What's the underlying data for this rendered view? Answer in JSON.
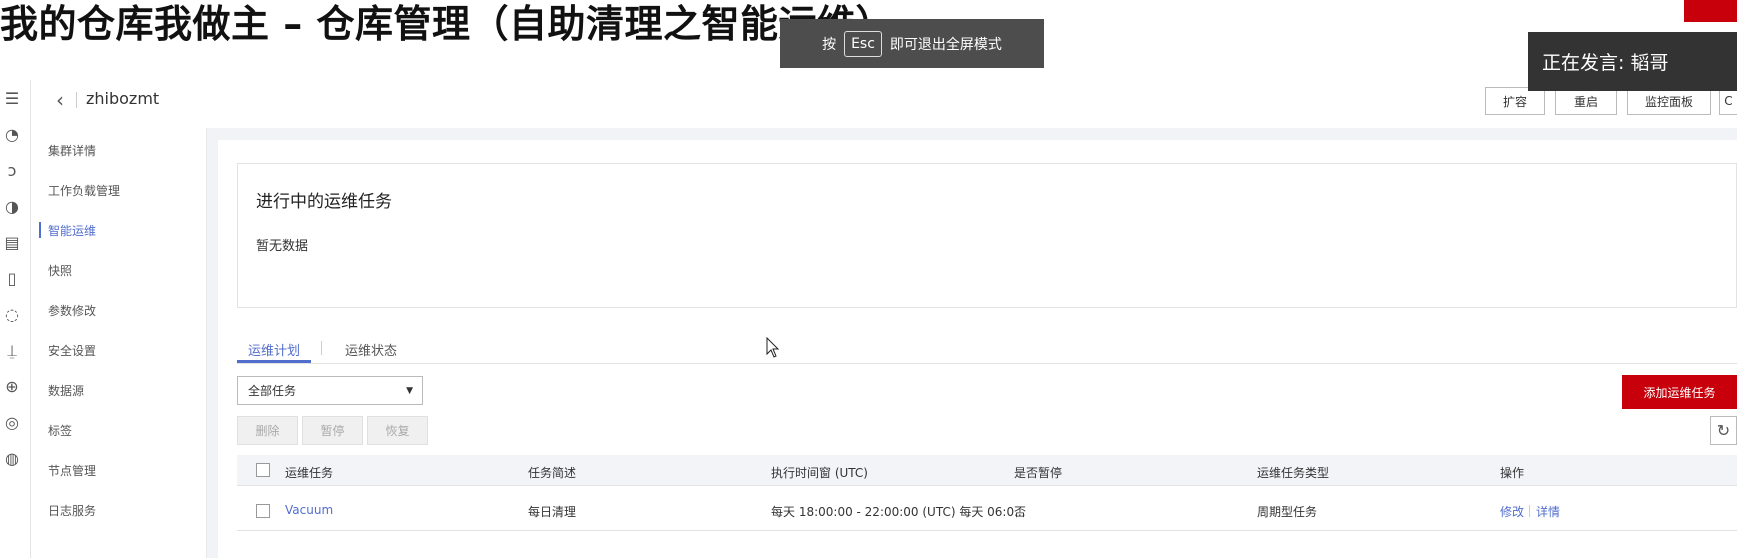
{
  "slide": {
    "title": "我的仓库我做主 – 仓库管理（自助清理之智能运维）"
  },
  "fullscreen_toast": {
    "before": "按",
    "key": "Esc",
    "after": "即可退出全屏模式"
  },
  "speaker": {
    "label": "正在发言: 韬哥"
  },
  "header": {
    "cluster_name": "zhibozmt",
    "buttons": [
      "扩容",
      "重启",
      "监控面板"
    ]
  },
  "nav": {
    "items": [
      "集群详情",
      "工作负载管理",
      "智能运维",
      "快照",
      "参数修改",
      "安全设置",
      "数据源",
      "标签",
      "节点管理",
      "日志服务"
    ],
    "active_index": 2
  },
  "card": {
    "title": "进行中的运维任务",
    "empty_text": "暂无数据"
  },
  "tabs": [
    {
      "label": "运维计划",
      "active": true
    },
    {
      "label": "运维状态",
      "active": false
    }
  ],
  "filter": {
    "value": "全部任务"
  },
  "actions": {
    "delete": "删除",
    "pause": "暂停",
    "resume": "恢复",
    "add": "添加运维任务"
  },
  "table": {
    "headers": [
      "运维任务",
      "任务简述",
      "执行时间窗 (UTC)",
      "是否暂停",
      "运维任务类型",
      "操作"
    ],
    "rows": [
      {
        "task": "Vacuum",
        "description": "每日清理",
        "window": "每天 18:00:00 - 22:00:00 (UTC)  每天 06:0...",
        "paused": "否",
        "type": "周期型任务",
        "op_edit": "修改",
        "op_detail": "详情"
      }
    ]
  },
  "colors": {
    "accent": "#526ecc",
    "brand_red": "#c7000b"
  },
  "icons": [
    "menu-icon",
    "chevron-left-icon",
    "refresh-icon",
    "caret-down-icon",
    "mouse-cursor-icon"
  ]
}
